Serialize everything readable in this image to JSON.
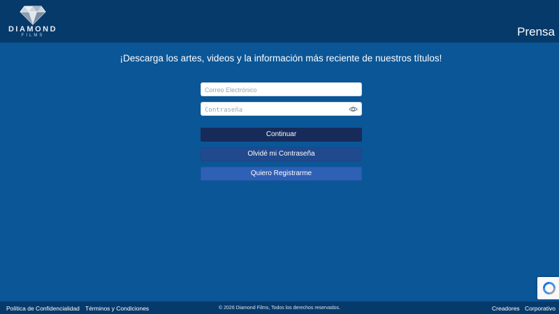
{
  "header": {
    "logo_word": "DIAMOND",
    "logo_sub": "FILMS",
    "section_title": "Prensa"
  },
  "main": {
    "tagline": "¡Descarga los artes, videos y la información más reciente de nuestros títulos!",
    "email_placeholder": "Correo Electrónico",
    "password_placeholder": "Contraseña",
    "continue_label": "Continuar",
    "forgot_label": "Olvidé mi Contraseña",
    "register_label": "Quiero Registrarme"
  },
  "footer": {
    "privacy": "Política de Confidencialidad",
    "terms": "Términos y Condiciones",
    "copyright": "© 2026 Diamond Films, Todos los derechos reservados.",
    "creators": "Creadores",
    "corporate": "Corporativo"
  },
  "icons": {
    "logo": "diamond-icon",
    "password_toggle": "eye-icon",
    "recaptcha": "recaptcha-icon"
  },
  "colors": {
    "background": "#0a5697",
    "header": "#063a6b",
    "continue_button": "#172b5b",
    "forgot_button": "#21498e",
    "register_button": "#2e60b5"
  }
}
